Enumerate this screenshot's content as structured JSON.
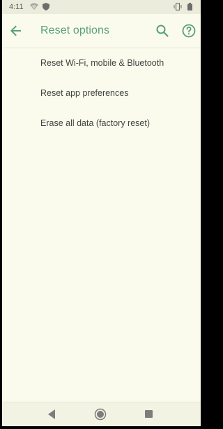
{
  "status_bar": {
    "time": "4:11",
    "icons": [
      "wifi-icon",
      "shield-icon",
      "vibrate-icon",
      "battery-icon"
    ]
  },
  "app_bar": {
    "title": "Reset options",
    "back_icon": "arrow-back-icon",
    "search_icon": "search-icon",
    "help_icon": "help-icon"
  },
  "list": {
    "items": [
      {
        "label": "Reset Wi-Fi, mobile & Bluetooth"
      },
      {
        "label": "Reset app preferences"
      },
      {
        "label": "Erase all data (factory reset)"
      }
    ]
  },
  "nav_bar": {
    "icons": [
      "nav-back-icon",
      "nav-home-icon",
      "nav-recents-icon"
    ]
  },
  "colors": {
    "accent": "#5a9f7c",
    "background": "#fbfbed",
    "text": "#3f4440"
  }
}
